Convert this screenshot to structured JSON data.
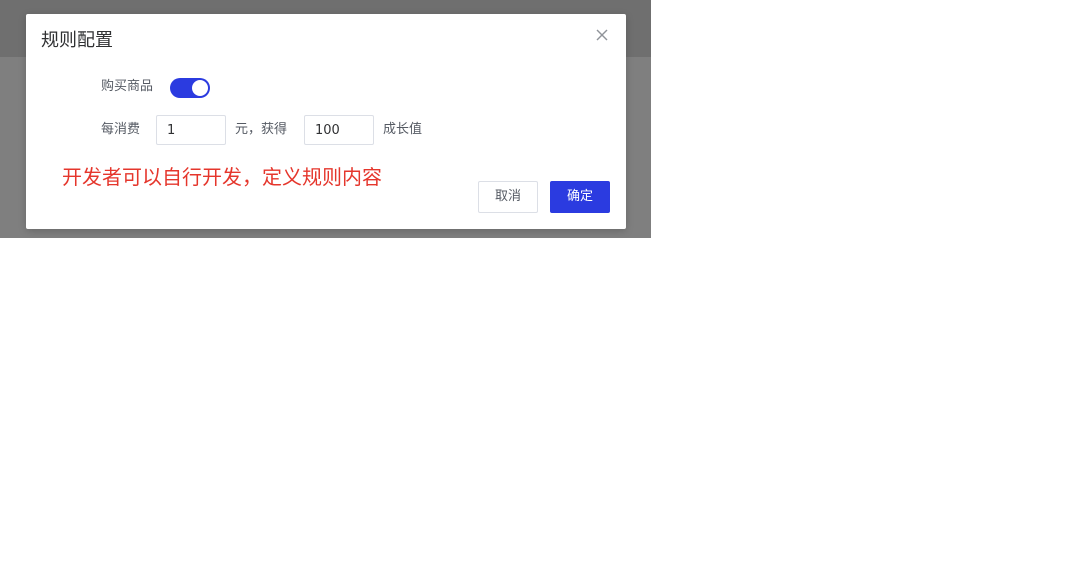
{
  "dialog": {
    "title": "规则配置",
    "close_icon": "close-icon"
  },
  "form": {
    "purchase_label": "购买商品",
    "purchase_toggle_on": true,
    "spend_prefix": "每消费",
    "spend_value": "1",
    "spend_unit_text": "元，获得",
    "growth_value": "100",
    "growth_suffix": "成长值"
  },
  "note": "开发者可以自行开发，定义规则内容",
  "buttons": {
    "cancel": "取消",
    "confirm": "确定"
  },
  "colors": {
    "accent": "#2b3be0",
    "note": "#e5362c",
    "overlay": "#7f7f7f"
  }
}
